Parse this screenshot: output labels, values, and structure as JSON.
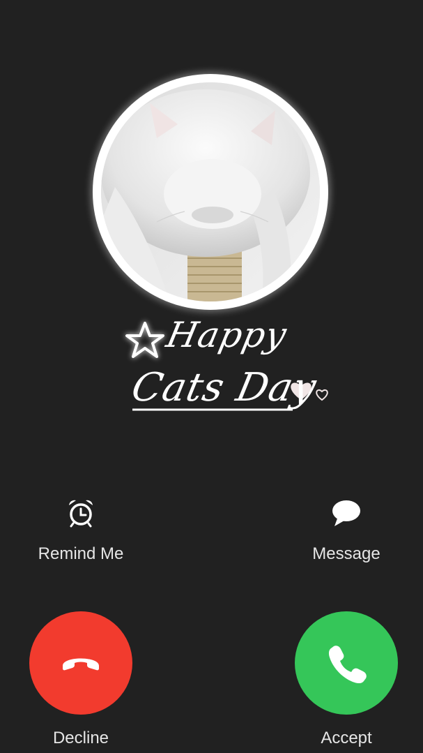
{
  "call": {
    "caller_line1": "Happy",
    "caller_line2": "Cats Day"
  },
  "avatar": {
    "icon": "cat-photo"
  },
  "actions": {
    "remind_label": "Remind Me",
    "remind_icon": "alarm-clock-icon",
    "message_label": "Message",
    "message_icon": "speech-bubble-icon"
  },
  "buttons": {
    "decline_label": "Decline",
    "decline_color": "#F23B2E",
    "accept_label": "Accept",
    "accept_color": "#35C659"
  },
  "colors": {
    "background": "#212121",
    "text": "#E6E6E6"
  }
}
